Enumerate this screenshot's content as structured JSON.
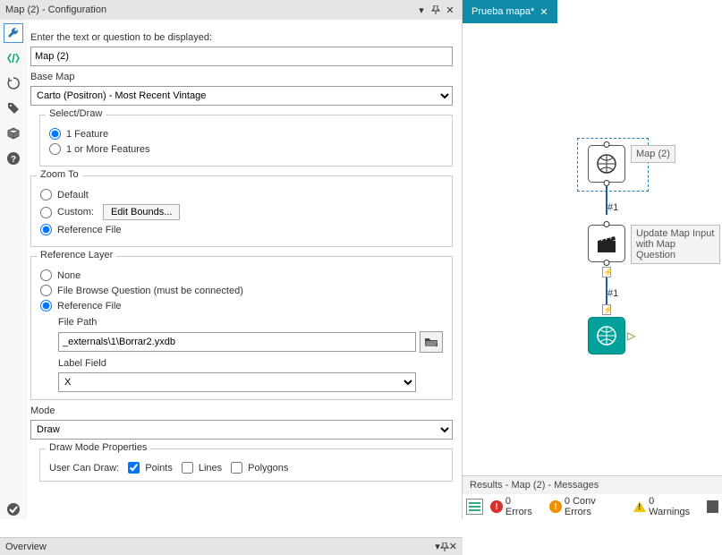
{
  "panel": {
    "title": "Map (2) - Configuration",
    "overview_title": "Overview"
  },
  "form": {
    "prompt_label": "Enter the text or question to be displayed:",
    "prompt_value": "Map (2)",
    "basemap_label": "Base Map",
    "basemap_value": "Carto (Positron) - Most Recent Vintage",
    "selectdraw": {
      "title": "Select/Draw",
      "opt1": "1 Feature",
      "opt2": "1 or More Features"
    },
    "zoom": {
      "title": "Zoom To",
      "opt1": "Default",
      "opt2": "Custom:",
      "editbounds": "Edit Bounds...",
      "opt3": "Reference File"
    },
    "reflayer": {
      "title": "Reference Layer",
      "opt1": "None",
      "opt2": "File Browse Question (must be connected)",
      "opt3": "Reference File",
      "filepath_label": "File Path",
      "filepath_value": "_externals\\1\\Borrar2.yxdb",
      "labelfield_label": "Label Field",
      "labelfield_value": "X"
    },
    "mode": {
      "label": "Mode",
      "value": "Draw"
    },
    "drawprops": {
      "title": "Draw Mode Properties",
      "usercandraw": "User Can Draw:",
      "points": "Points",
      "lines": "Lines",
      "polygons": "Polygons"
    }
  },
  "canvas": {
    "tab_title": "Prueba mapa*",
    "node1_label": "Map (2)",
    "node2_label": "Update Map Input with Map Question",
    "edge1": "#1",
    "edge2": "#1"
  },
  "results": {
    "title": "Results - Map (2) - Messages",
    "errors": "0 Errors",
    "conv": "0 Conv Errors",
    "warnings": "0 Warnings"
  }
}
